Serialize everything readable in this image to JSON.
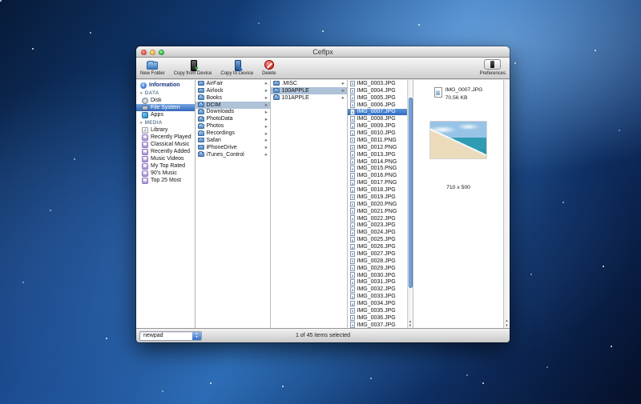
{
  "window": {
    "title": "Ceflpx",
    "toolbar": {
      "buttons": [
        {
          "label": "New Folder",
          "icon": "new-folder-icon"
        },
        {
          "label": "Copy from Device",
          "icon": "copy-from-device-icon"
        },
        {
          "label": "Copy to Device",
          "icon": "copy-to-device-icon"
        },
        {
          "label": "Delete",
          "icon": "delete-icon"
        }
      ],
      "preferences": {
        "label": "Preferences",
        "icon": "device-icon"
      }
    },
    "sidebar": {
      "information": {
        "label": "Information",
        "icon": "info-icon"
      },
      "sections": [
        {
          "label": "DATA",
          "items": [
            {
              "label": "Disk",
              "icon": "disk-icon"
            },
            {
              "label": "File System",
              "icon": "filesystem-icon",
              "selected": true
            },
            {
              "label": "Apps",
              "icon": "apps-icon"
            }
          ]
        },
        {
          "label": "MEDIA",
          "items": [
            {
              "label": "Library",
              "icon": "library-icon"
            },
            {
              "label": "Recently Played",
              "icon": "playlist-icon"
            },
            {
              "label": "Classical Music",
              "icon": "playlist-icon"
            },
            {
              "label": "Recently Added",
              "icon": "playlist-icon"
            },
            {
              "label": "Music Videos",
              "icon": "playlist-icon"
            },
            {
              "label": "My Top Rated",
              "icon": "playlist-icon"
            },
            {
              "label": "90's Music",
              "icon": "playlist-icon"
            },
            {
              "label": "Top 25 Most",
              "icon": "playlist-icon"
            }
          ]
        }
      ]
    },
    "columns": {
      "folders1": [
        {
          "name": "AirFair"
        },
        {
          "name": "Airlock"
        },
        {
          "name": "Books"
        },
        {
          "name": "DCIM",
          "selected": true
        },
        {
          "name": "Downloads"
        },
        {
          "name": "PhotoData"
        },
        {
          "name": "Photos"
        },
        {
          "name": "Recordings"
        },
        {
          "name": "Safari"
        },
        {
          "name": "iPhoneDrive"
        },
        {
          "name": "iTunes_Control"
        }
      ],
      "folders2": [
        {
          "name": ".MISC"
        },
        {
          "name": "100APPLE",
          "selected": true
        },
        {
          "name": "101APPLE"
        }
      ],
      "files": [
        {
          "name": "IMG_0003.JPG"
        },
        {
          "name": "IMG_0004.JPG"
        },
        {
          "name": "IMG_0005.JPG"
        },
        {
          "name": "IMG_0006.JPG"
        },
        {
          "name": "IMG_0007.JPG",
          "selected": true
        },
        {
          "name": "IMG_0008.JPG"
        },
        {
          "name": "IMG_0009.JPG"
        },
        {
          "name": "IMG_0010.JPG"
        },
        {
          "name": "IMG_0011.PNG"
        },
        {
          "name": "IMG_0012.PNG"
        },
        {
          "name": "IMG_0013.JPG"
        },
        {
          "name": "IMG_0014.PNG"
        },
        {
          "name": "IMG_0015.PNG"
        },
        {
          "name": "IMG_0016.PNG"
        },
        {
          "name": "IMG_0017.PNG"
        },
        {
          "name": "IMG_0018.JPG"
        },
        {
          "name": "IMG_0019.JPG"
        },
        {
          "name": "IMG_0020.PNG"
        },
        {
          "name": "IMG_0021.PNG"
        },
        {
          "name": "IMG_0022.JPG"
        },
        {
          "name": "IMG_0023.JPG"
        },
        {
          "name": "IMG_0024.JPG"
        },
        {
          "name": "IMG_0025.JPG"
        },
        {
          "name": "IMG_0026.JPG"
        },
        {
          "name": "IMG_0027.JPG"
        },
        {
          "name": "IMG_0028.JPG"
        },
        {
          "name": "IMG_0029.JPG"
        },
        {
          "name": "IMG_0030.JPG"
        },
        {
          "name": "IMG_0031.JPG"
        },
        {
          "name": "IMG_0032.JPG"
        },
        {
          "name": "IMG_0033.JPG"
        },
        {
          "name": "IMG_0034.JPG"
        },
        {
          "name": "IMG_0035.JPG"
        },
        {
          "name": "IMG_0036.JPG"
        },
        {
          "name": "IMG_0037.JPG"
        }
      ]
    },
    "preview": {
      "filename": "IMG_0007.JPG",
      "filesize": "70.56 KB",
      "dimensions": "710 x 500"
    },
    "statusbar": {
      "device": "newpad",
      "status": "1 of 45 items selected"
    }
  }
}
